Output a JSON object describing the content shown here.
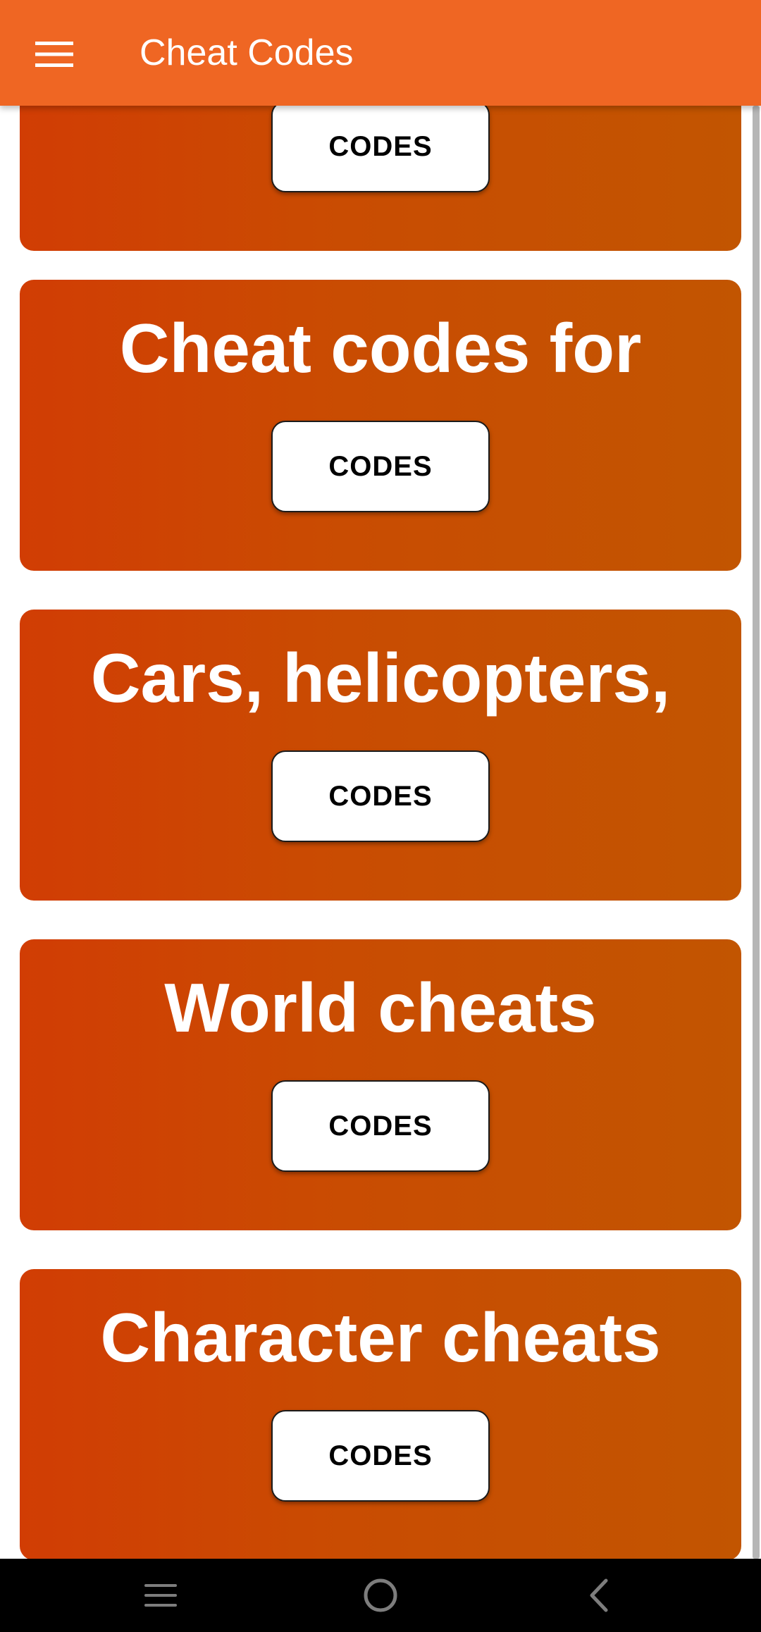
{
  "appbar": {
    "title": "Cheat Codes",
    "menu_icon": "hamburger-menu-icon",
    "color": "#ef6623"
  },
  "cards": [
    {
      "title": "",
      "button_label": "CODES"
    },
    {
      "title": "Cheat codes for",
      "button_label": "CODES"
    },
    {
      "title": "Cars, helicopters,",
      "button_label": "CODES"
    },
    {
      "title": "World cheats",
      "button_label": "CODES"
    },
    {
      "title": "Character cheats",
      "button_label": "CODES"
    }
  ],
  "theme": {
    "card_gradient_start": "#d13d04",
    "card_gradient_end": "#c25501",
    "button_background": "#ffffff"
  },
  "navbar": {
    "recent_apps_icon": "recent-apps-icon",
    "home_icon": "home-icon",
    "back_icon": "back-icon"
  }
}
